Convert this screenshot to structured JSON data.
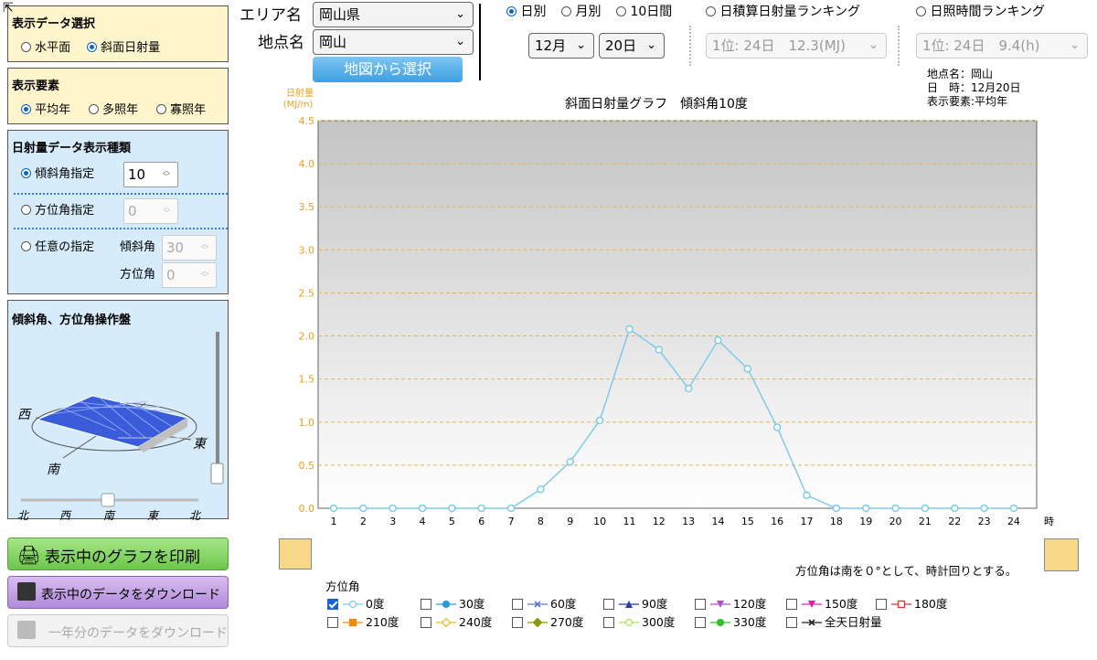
{
  "panel_data": {
    "title": "表示データ選択",
    "options": [
      "水平面",
      "斜面日射量"
    ],
    "selected": 1
  },
  "panel_element": {
    "title": "表示要素",
    "options": [
      "平均年",
      "多照年",
      "寡照年"
    ],
    "selected": 0
  },
  "panel_kind": {
    "title": "日射量データ表示種類",
    "tilt_label": "傾斜角指定",
    "tilt_value": "10",
    "azimuth_label": "方位角指定",
    "azimuth_value": "0",
    "free_label": "任意の指定",
    "free_tilt_label": "傾斜角",
    "free_tilt_value": "30",
    "free_az_label": "方位角",
    "free_az_value": "0"
  },
  "panel_control": {
    "title": "傾斜角、方位角操作盤",
    "west": "西",
    "east": "東",
    "south": "南",
    "scale": [
      "北",
      "西",
      "南",
      "東",
      "北"
    ]
  },
  "buttons": {
    "print": "表示中のグラフを印刷",
    "download": "表示中のデータをダウンロード",
    "download_year": "一年分のデータをダウンロード"
  },
  "header": {
    "area_label": "エリア名",
    "area_value": "岡山県",
    "point_label": "地点名",
    "point_value": "岡山",
    "map_button": "地図から選択",
    "period_options": [
      "日別",
      "月別",
      "10日間"
    ],
    "period_selected": 0,
    "month": "12月",
    "day": "20日",
    "rank1_label": "日積算日射量ランキング",
    "rank1_value": "1位: 24日　12.3(MJ)",
    "rank2_label": "日照時間ランキング",
    "rank2_value": "1位: 24日　9.4(h)"
  },
  "info": {
    "line1": "地点名：岡山",
    "line2": "日　時：12月20日",
    "line3": "表示要素:平均年"
  },
  "note": "方位角は南を０°として、時計回りとする。",
  "legend_title": "方位角",
  "colors": {
    "accent": "#0a64c8",
    "series": "#7ecbe6",
    "axis": "#e8a020",
    "grid": "#e6b454",
    "print_btn": "#7cd25a",
    "download_btn": "#b68bd8"
  },
  "chart_data": {
    "type": "line",
    "title": "斜面日射量グラフ　傾斜角10度",
    "ylabel": "日射量\n(MJ/m)",
    "xlabel": "時",
    "ylim": [
      0,
      4.5
    ],
    "yticks": [
      "0.0",
      "0.5",
      "1.0",
      "1.5",
      "2.0",
      "2.5",
      "3.0",
      "3.5",
      "4.0",
      "4.5"
    ],
    "x": [
      1,
      2,
      3,
      4,
      5,
      6,
      7,
      8,
      9,
      10,
      11,
      12,
      13,
      14,
      15,
      16,
      17,
      18,
      19,
      20,
      21,
      22,
      23,
      24
    ],
    "series": [
      {
        "name": "0度",
        "values": [
          0,
          0,
          0,
          0,
          0,
          0,
          0,
          0.22,
          0.54,
          1.02,
          2.08,
          1.84,
          1.39,
          1.95,
          1.62,
          0.94,
          0.15,
          0,
          0,
          0,
          0,
          0,
          0,
          0
        ]
      }
    ],
    "legend": [
      {
        "label": "0度",
        "checked": true,
        "color": "#7ecbe6",
        "marker": "circle-open"
      },
      {
        "label": "30度",
        "checked": false,
        "color": "#2a9ad6",
        "marker": "circle"
      },
      {
        "label": "60度",
        "checked": false,
        "color": "#5a78d6",
        "marker": "x"
      },
      {
        "label": "90度",
        "checked": false,
        "color": "#2a3aa8",
        "marker": "triangle"
      },
      {
        "label": "120度",
        "checked": false,
        "color": "#b050c8",
        "marker": "triangle-down"
      },
      {
        "label": "150度",
        "checked": false,
        "color": "#e020a0",
        "marker": "triangle-down"
      },
      {
        "label": "180度",
        "checked": false,
        "color": "#e83030",
        "marker": "square-open"
      },
      {
        "label": "210度",
        "checked": false,
        "color": "#f08a10",
        "marker": "square"
      },
      {
        "label": "240度",
        "checked": false,
        "color": "#e8c030",
        "marker": "diamond-open"
      },
      {
        "label": "270度",
        "checked": false,
        "color": "#8a9a10",
        "marker": "diamond"
      },
      {
        "label": "300度",
        "checked": false,
        "color": "#b0e060",
        "marker": "circle-open"
      },
      {
        "label": "330度",
        "checked": false,
        "color": "#30c030",
        "marker": "circle"
      },
      {
        "label": "全天日射量",
        "checked": false,
        "color": "#222222",
        "marker": "x"
      }
    ]
  }
}
